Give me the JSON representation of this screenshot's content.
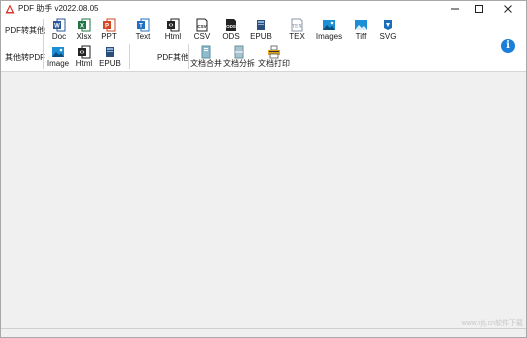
{
  "window": {
    "title": "PDF 助手 v2022.08.05"
  },
  "toolbar": {
    "pdf_to_other_label": "PDF转其他",
    "other_to_pdf_label": "其他转PDF",
    "pdf_other_label": "PDF其他",
    "pdf_to_other": [
      {
        "label": "Doc",
        "icon": "word-icon",
        "color": "#2b579a"
      },
      {
        "label": "Xlsx",
        "icon": "excel-icon",
        "color": "#217346"
      },
      {
        "label": "PPT",
        "icon": "powerpoint-icon",
        "color": "#d24726"
      },
      {
        "label": "Text",
        "icon": "text-icon",
        "color": "#1f6fc5"
      },
      {
        "label": "Html",
        "icon": "html-icon",
        "color": "#222222"
      },
      {
        "label": "CSV",
        "icon": "csv-icon",
        "color": "#222222"
      },
      {
        "label": "ODS",
        "icon": "ods-icon",
        "color": "#222222"
      },
      {
        "label": "EPUB",
        "icon": "epub-icon",
        "color": "#2b4f7a"
      },
      {
        "label": "TEX",
        "icon": "tex-icon",
        "color": "#6b7b8c"
      },
      {
        "label": "Images",
        "icon": "image-icon",
        "color": "#1a8fd6"
      },
      {
        "label": "Tiff",
        "icon": "tiff-icon",
        "color": "#1a8fd6"
      },
      {
        "label": "SVG",
        "icon": "svg-icon",
        "color": "#1a6fb8"
      }
    ],
    "other_to_pdf": [
      {
        "label": "Image",
        "icon": "image-icon",
        "color": "#1a8fd6"
      },
      {
        "label": "Html",
        "icon": "html-icon",
        "color": "#222222"
      },
      {
        "label": "EPUB",
        "icon": "epub-icon",
        "color": "#2b4f7a"
      }
    ],
    "pdf_other": [
      {
        "label": "文档合并",
        "icon": "merge-icon",
        "color": "#6a9fb5"
      },
      {
        "label": "文档分拆",
        "icon": "split-icon",
        "color": "#6a9fb5"
      },
      {
        "label": "文档打印",
        "icon": "print-icon",
        "color": "#e0a020"
      }
    ],
    "info_symbol": "i"
  },
  "watermark": "www.rjtj.cn软件下载"
}
